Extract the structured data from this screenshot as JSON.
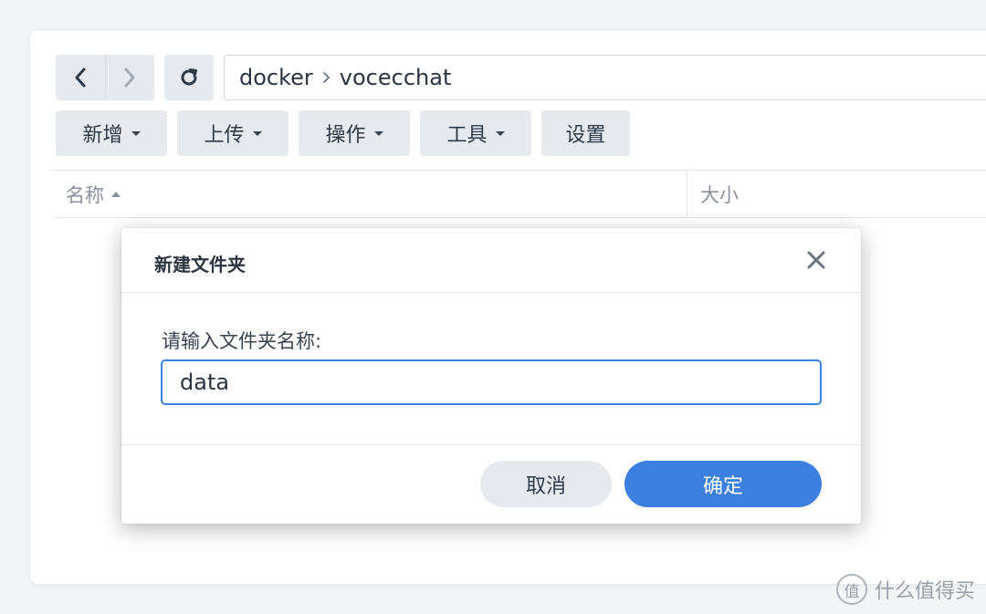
{
  "path": {
    "crumbs": [
      "docker",
      "vocecchat"
    ]
  },
  "toolbar": {
    "new_label": "新增",
    "upload_label": "上传",
    "action_label": "操作",
    "tools_label": "工具",
    "settings_label": "设置"
  },
  "table": {
    "columns": [
      "名称",
      "大小"
    ]
  },
  "dialog": {
    "title": "新建文件夹",
    "prompt": "请输入文件夹名称:",
    "input_value": "data",
    "cancel_label": "取消",
    "confirm_label": "确定"
  },
  "watermark": {
    "logo_char": "值",
    "text": "什么值得买"
  },
  "colors": {
    "accent": "#3b80e0",
    "button_bg": "#e6e9ee"
  }
}
